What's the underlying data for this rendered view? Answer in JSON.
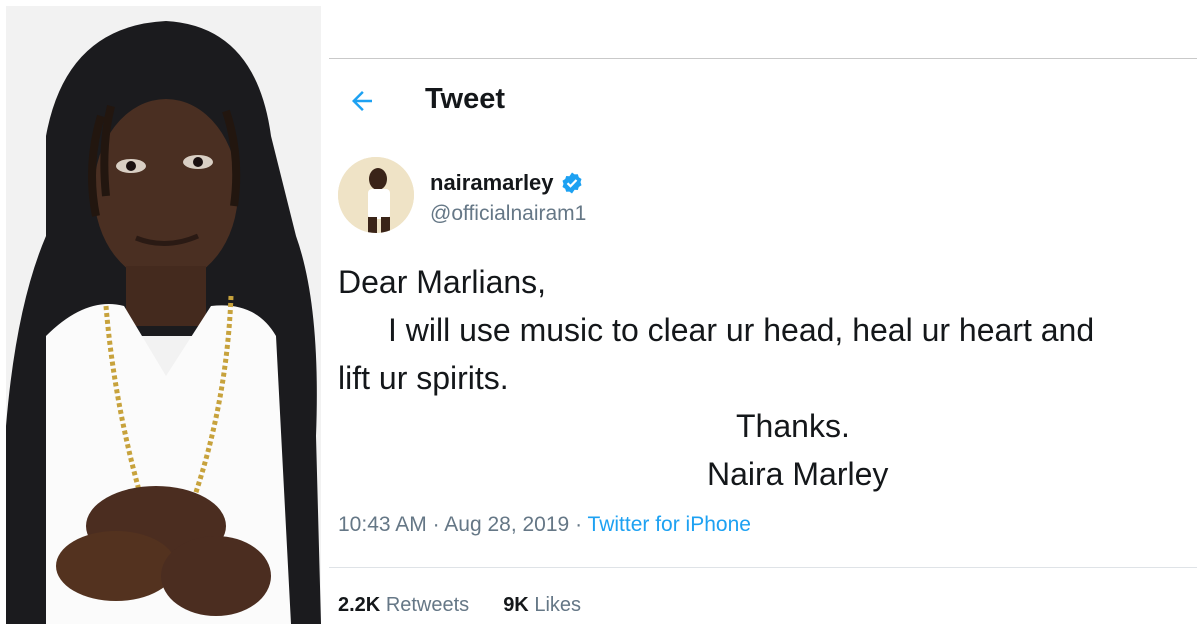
{
  "header": {
    "title": "Tweet"
  },
  "author": {
    "display_name": "nairamarley",
    "handle": "@officialnairam1",
    "verified": true
  },
  "tweet": {
    "lines": [
      "Dear Marlians,",
      "I will use music to clear ur head, heal ur heart and",
      "lift ur spirits.",
      "Thanks.",
      "Naira Marley"
    ],
    "time": "10:43 AM",
    "separator": "·",
    "date": "Aug 28, 2019",
    "source": "Twitter for iPhone"
  },
  "stats": {
    "retweets_count": "2.2K",
    "retweets_label": "Retweets",
    "likes_count": "9K",
    "likes_label": "Likes"
  },
  "colors": {
    "accent": "#1DA1F2",
    "text": "#14171a",
    "muted": "#657786"
  }
}
